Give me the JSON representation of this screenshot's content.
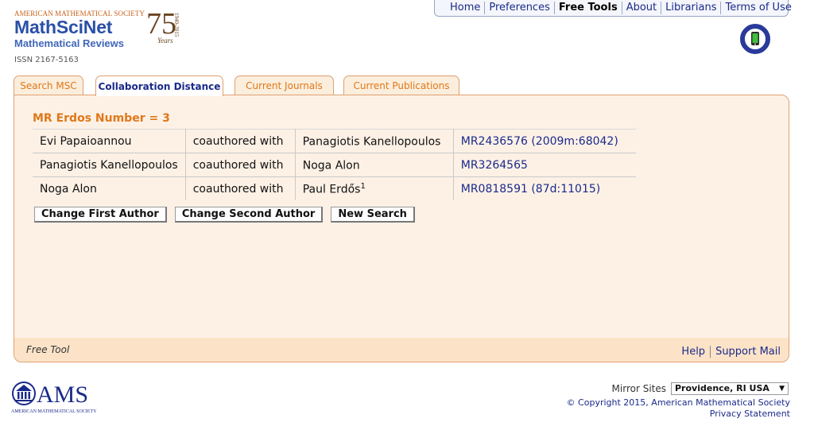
{
  "nav": {
    "items": [
      {
        "label": "Home",
        "active": false
      },
      {
        "label": "Preferences",
        "active": false
      },
      {
        "label": "Free Tools",
        "active": true
      },
      {
        "label": "About",
        "active": false
      },
      {
        "label": "Librarians",
        "active": false
      },
      {
        "label": "Terms of Use",
        "active": false
      }
    ]
  },
  "brand": {
    "society": "AMERICAN MATHEMATICAL SOCIETY",
    "product": "MathSciNet",
    "subtitle": "Mathematical Reviews",
    "anniversary": "75",
    "years_word": "Years",
    "year_span": "1940-2015",
    "issn": "ISSN 2167-5163",
    "mobile_badge_text": "MOBILE ACCESS"
  },
  "tabs": [
    {
      "label": "Search MSC",
      "active": false
    },
    {
      "label": "Collaboration Distance",
      "active": true
    },
    {
      "label": "Current Journals",
      "active": false
    },
    {
      "label": "Current Publications",
      "active": false
    }
  ],
  "result": {
    "heading": "MR Erdos Number = 3",
    "rows": [
      {
        "author_a": "Evi Papaioannou",
        "relation": "coauthored with",
        "author_b": "Panagiotis Kanellopoulos",
        "author_b_sup": "",
        "mr": "MR2436576 (2009m:68042)"
      },
      {
        "author_a": "Panagiotis Kanellopoulos",
        "relation": "coauthored with",
        "author_b": "Noga Alon",
        "author_b_sup": "",
        "mr": "MR3264565"
      },
      {
        "author_a": "Noga Alon",
        "relation": "coauthored with",
        "author_b": "Paul Erdős",
        "author_b_sup": "1",
        "mr": "MR0818591 (87d:11015)"
      }
    ]
  },
  "buttons": {
    "change_first": "Change First Author",
    "change_second": "Change Second Author",
    "new_search": "New Search"
  },
  "footer": {
    "free_tool": "Free Tool",
    "help": "Help",
    "support": "Support Mail"
  },
  "bottom": {
    "ams_logo_text": "AMS",
    "ams_logo_sub": "AMERICAN MATHEMATICAL SOCIETY",
    "mirror_label": "Mirror Sites",
    "mirror_selected": "Providence, RI USA",
    "copyright": "© Copyright 2015, American Mathematical Society",
    "privacy": "Privacy Statement"
  },
  "colors": {
    "accent_orange": "#e07818",
    "link_blue": "#1a2a8a",
    "panel_bg": "#fdf1e6"
  }
}
